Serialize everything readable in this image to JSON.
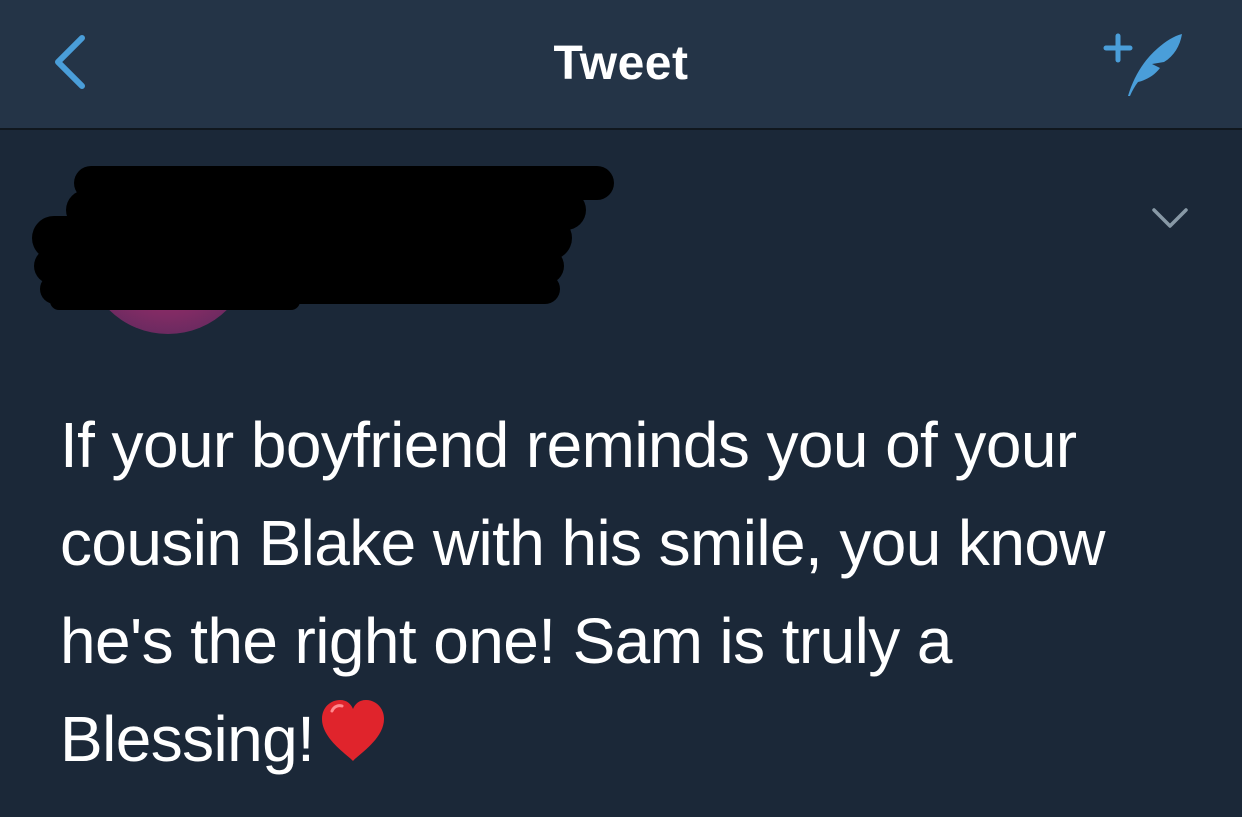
{
  "navbar": {
    "title": "Tweet",
    "back_icon": "chevron-left-icon",
    "compose_icon": "compose-tweet-icon",
    "accent_color": "#4a9ed9"
  },
  "author": {
    "display_name": "",
    "handle": "",
    "redacted": true,
    "menu_icon": "chevron-down-icon"
  },
  "tweet": {
    "text": "If your boyfriend reminds you of your cousin Blake with his smile, you know he's the right one! Sam is truly a Blessing!",
    "emoji": "red-heart-emoji"
  },
  "colors": {
    "background": "#1b2838",
    "navbar": "#243447",
    "text": "#ffffff",
    "secondary_text": "#8899a6"
  }
}
